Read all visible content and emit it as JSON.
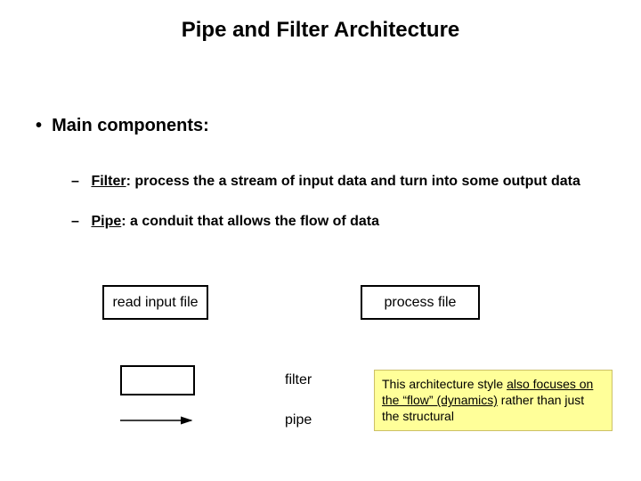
{
  "title": "Pipe and Filter Architecture",
  "main_heading": "Main components:",
  "defs": {
    "filter_term": "Filter",
    "filter_text": ": process the a stream of input data and turn into some output data",
    "pipe_term": "Pipe",
    "pipe_text": ": a conduit that allows the flow of data"
  },
  "diagram": {
    "box1": "read input file",
    "box2": "process file",
    "legend_filter": "filter",
    "legend_pipe": "pipe"
  },
  "note": {
    "line1_pre": "This architecture style ",
    "line1_under": "also focuses on the “flow” (dynamics)",
    "line2": " rather than just the structural"
  }
}
